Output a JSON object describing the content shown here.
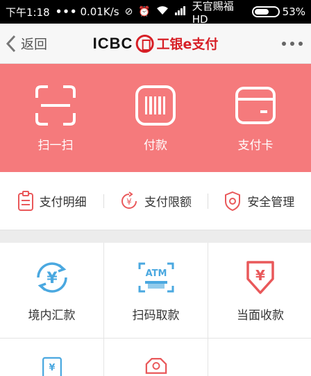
{
  "status_bar": {
    "time": "下午1:18",
    "dots": "•••",
    "speed": "0.01K/s",
    "carrier": "天官赐福 HD",
    "battery": "53%"
  },
  "navbar": {
    "back_label": "返回",
    "brand_en": "ICBC",
    "brand_cn": "工银e支付"
  },
  "hero": {
    "items": [
      {
        "label": "扫一扫"
      },
      {
        "label": "付款"
      },
      {
        "label": "支付卡"
      }
    ]
  },
  "quick": {
    "items": [
      {
        "label": "支付明细"
      },
      {
        "label": "支付限额"
      },
      {
        "label": "安全管理"
      }
    ]
  },
  "grid": {
    "items": [
      {
        "label": "境内汇款"
      },
      {
        "label": "扫码取款",
        "badge": "ATM"
      },
      {
        "label": "当面收款"
      }
    ]
  },
  "colors": {
    "hero_bg": "#f57a7c",
    "accent_blue": "#4aa8e0",
    "accent_red": "#e9585a",
    "brand_red": "#d71f26"
  }
}
